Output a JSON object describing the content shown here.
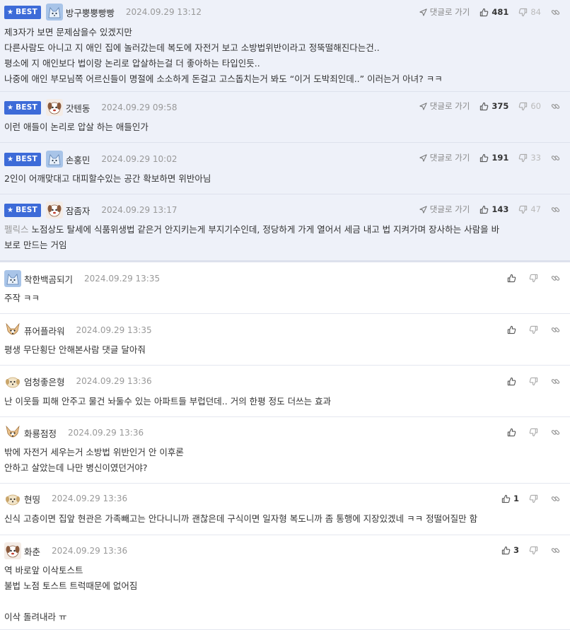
{
  "labels": {
    "best": "BEST",
    "reply": "댓글로 가기"
  },
  "colors": {
    "best_badge": "#3d6bd8",
    "best_bg": "#eef1f9"
  },
  "comments": [
    {
      "nick": "방구뿡뿡빵빵",
      "date": "2024.09.29 13:12",
      "up": "481",
      "down": "84",
      "best": true,
      "avatar": "fox-icon",
      "lines": [
        "제3자가 보면 문제삼을수 있겠지만",
        "다른사람도 아니고 지 애인 집에 놀러갔는데 복도에 자전거 보고 소방법위반이라고 정뚝떨해진다는건..",
        "평소에 지 애인보다 법이랑 논리로 압살하는걸 더 좋아하는 타입인듯..",
        "나중에 애인 부모님쪽 어르신들이 명절에 소소하게 돈걸고 고스돕치는거 봐도 “이거 도박죄인데..” 이러는거 아녀? ㅋㅋ"
      ]
    },
    {
      "nick": "갓텐동",
      "date": "2024.09.29 09:58",
      "up": "375",
      "down": "60",
      "best": true,
      "avatar": "dog-icon",
      "lines": [
        "이런 애들이 논리로 압살 하는 애들인가"
      ]
    },
    {
      "nick": "손홍민",
      "date": "2024.09.29 10:02",
      "up": "191",
      "down": "33",
      "best": true,
      "avatar": "fox-icon",
      "lines": [
        "2인이 어깨맞대고 대피할수있는 공간 확보하면 위반아님"
      ]
    },
    {
      "nick": "잠좀자",
      "date": "2024.09.29 13:17",
      "up": "143",
      "down": "47",
      "best": true,
      "avatar": "dog-icon",
      "mention": "펠릭스",
      "lines": [
        "노점상도 탈세에 식품위생법 같은거 안지키는게 부지기수인데, 정당하게 가게 열어서 세금 내고 법 지켜가며 장사하는 사람을 바",
        "보로 만드는 거임"
      ]
    },
    {
      "nick": "착한백곰되기",
      "date": "2024.09.29 13:35",
      "up": "",
      "down": "",
      "best": false,
      "avatar": "fox-icon",
      "lines": [
        "주작 ㅋㅋ"
      ]
    },
    {
      "nick": "퓨어플라워",
      "date": "2024.09.29 13:35",
      "up": "",
      "down": "",
      "best": false,
      "avatar": "chihuahua-icon",
      "lines": [
        "평생 무단횡단 안해본사람 댓글 달아줘"
      ]
    },
    {
      "nick": "엄청좋은형",
      "date": "2024.09.29 13:36",
      "up": "",
      "down": "",
      "best": false,
      "avatar": "puppy-icon",
      "lines": [
        "난 이웃들 피해 안주고 물건 놔둘수 있는 아파트들 부럽던데.. 거의 한평 정도 더쓰는 효과"
      ]
    },
    {
      "nick": "화룡점정",
      "date": "2024.09.29 13:36",
      "up": "",
      "down": "",
      "best": false,
      "avatar": "chihuahua-icon",
      "lines": [
        "밖에 자전거 세우는거 소방법 위반인거 안 이후론",
        "안하고 살았는데 나만 병신이였던거야?"
      ]
    },
    {
      "nick": "현띵",
      "date": "2024.09.29 13:36",
      "up": "1",
      "down": "",
      "best": false,
      "avatar": "puppy-icon",
      "lines": [
        "신식 고층이면 집앞 현관은 가족빼고는 안다니니까 괜찮은데 구식이면 일자형 복도니까 좀 통행에 지장있겠네 ㅋㅋ 정떨어질만 함"
      ]
    },
    {
      "nick": "화춘",
      "date": "2024.09.29 13:36",
      "up": "3",
      "down": "",
      "best": false,
      "avatar": "dog-icon",
      "lines": [
        "역 바로앞 이삭토스트",
        "불법 노점 토스트 트럭때문에 없어짐",
        "",
        "이삭 돌려내라 ㅠ"
      ]
    }
  ]
}
